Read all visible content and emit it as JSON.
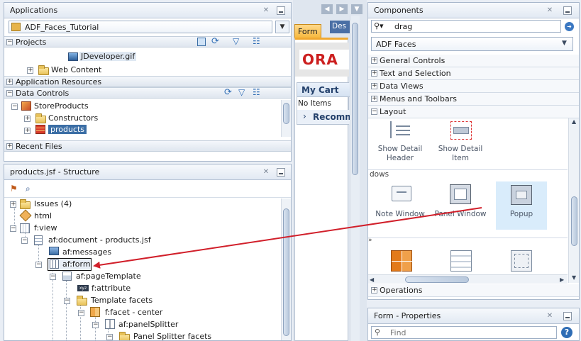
{
  "applications": {
    "title": "Applications",
    "project_select": "ADF_Faces_Tutorial",
    "sections": {
      "projects": "Projects",
      "application_resources": "Application Resources",
      "data_controls": "Data Controls",
      "recent_files": "Recent Files"
    },
    "projects_items": [
      "JDeveloper.gif",
      "Web Content"
    ],
    "data_controls_items": [
      "StoreProducts",
      "Constructors",
      "products"
    ]
  },
  "structure": {
    "title": "products.jsf - Structure",
    "nodes": [
      "Issues (4)",
      "html",
      "f:view",
      "af:document - products.jsf",
      "af:messages",
      "af:form",
      "af:pageTemplate",
      "f:attribute",
      "Template facets",
      "f:facet - center",
      "af:panelSplitter",
      "Panel Splitter facets"
    ]
  },
  "editor": {
    "tabs": [
      "Form",
      "Des"
    ],
    "brand_text": "ORA",
    "cart_title": "My Cart",
    "cart_empty": "No Items",
    "recommended": "Recomm",
    "fragment": "dows"
  },
  "components": {
    "title": "Components",
    "search_value": "drag",
    "library": "ADF Faces",
    "categories": [
      "General Controls",
      "Text and Selection",
      "Data Views",
      "Menus and Toolbars",
      "Layout"
    ],
    "layout_items": [
      "Show Detail Header",
      "Show Detail Item",
      "Note Window",
      "Panel Window",
      "Popup"
    ],
    "operations": "Operations"
  },
  "properties": {
    "title": "Form - Properties",
    "find_placeholder": "Find"
  },
  "colors": {
    "accent_orange": "#d8731a",
    "selection_blue": "#3b6ea5",
    "arrow_red": "#d11f2a",
    "popup_highlight": "#d9ecfb"
  }
}
